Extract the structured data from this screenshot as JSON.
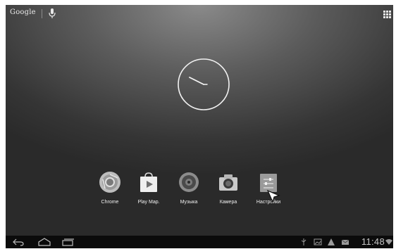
{
  "search_bar": {
    "label": "Google"
  },
  "apps": [
    {
      "id": "chrome",
      "label": "Chrome",
      "icon": "chrome-icon"
    },
    {
      "id": "play",
      "label": "Play Map.",
      "icon": "play-store-icon"
    },
    {
      "id": "music",
      "label": "Музыка",
      "icon": "music-speaker-icon"
    },
    {
      "id": "camera",
      "label": "Камера",
      "icon": "camera-icon"
    },
    {
      "id": "settings",
      "label": "Настройки",
      "icon": "settings-icon"
    }
  ],
  "status_bar": {
    "time": "11:48"
  },
  "colors": {
    "wallpaper_top": "#8a8a8a",
    "wallpaper_bottom": "#2a2a2a",
    "navbar": "#0b0b0b",
    "text": "#f0f0f0"
  }
}
